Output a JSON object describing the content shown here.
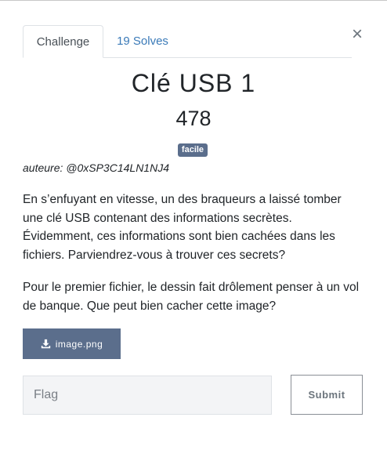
{
  "modal": {
    "close_icon": "×",
    "tabs": [
      {
        "label": "Challenge",
        "active": true
      },
      {
        "label": "19 Solves",
        "active": false
      }
    ],
    "title": "Clé USB 1",
    "points": "478",
    "difficulty": "facile",
    "author": "auteure: @0xSP3C14LN1NJ4",
    "description": [
      "En s’enfuyant en vitesse, un des braqueurs a laissé tomber une clé USB contenant des informations secrètes. Évidemment, ces informations sont bien cachées dans les fichiers. Parviendrez-vous à trouver ces secrets?",
      "Pour le premier fichier, le dessin fait drôlement penser à un vol de banque. Que peut bien cacher cette image?"
    ],
    "file": {
      "icon": "download-icon",
      "label": "image.png"
    },
    "flag_input": {
      "placeholder": "Flag",
      "value": ""
    },
    "submit_label": "Submit"
  },
  "colors": {
    "accent": "#5b6e8c",
    "link": "#3a7ab8",
    "text": "#212529"
  }
}
